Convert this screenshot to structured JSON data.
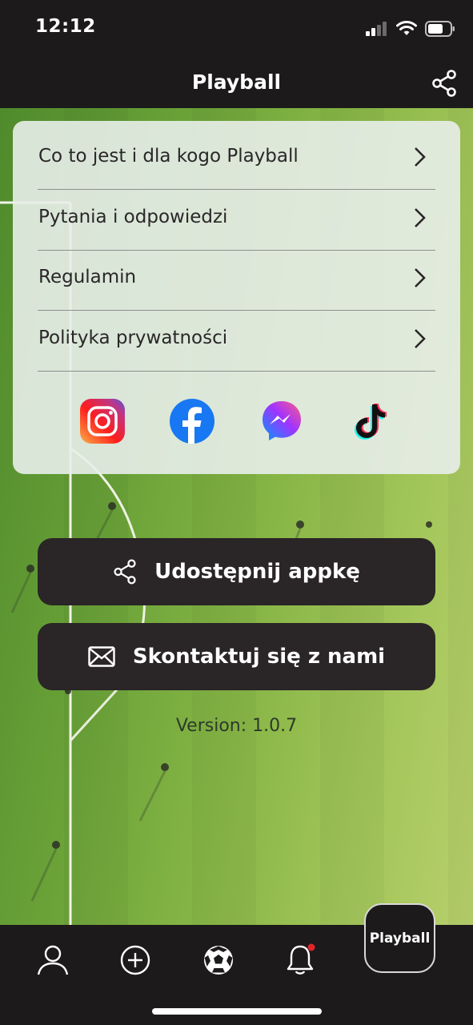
{
  "status_bar": {
    "time": "12:12"
  },
  "nav": {
    "title": "Playball",
    "share_icon": "share-icon"
  },
  "menu": {
    "items": [
      {
        "label": "Co to jest i dla kogo Playball"
      },
      {
        "label": "Pytania i odpowiedzi"
      },
      {
        "label": "Regulamin"
      },
      {
        "label": "Polityka prywatności"
      }
    ],
    "socials": [
      "instagram-icon",
      "facebook-icon",
      "messenger-icon",
      "tiktok-icon"
    ]
  },
  "buttons": {
    "share_app": "Udostępnij appkę",
    "contact": "Skontaktuj się z nami"
  },
  "version": "Version: 1.0.7",
  "tab_bar": {
    "tabs": [
      "profile-icon",
      "add-icon",
      "football-icon",
      "bell-icon"
    ],
    "playball_label": "Playball",
    "notification_dot_color": "#e0262a"
  }
}
